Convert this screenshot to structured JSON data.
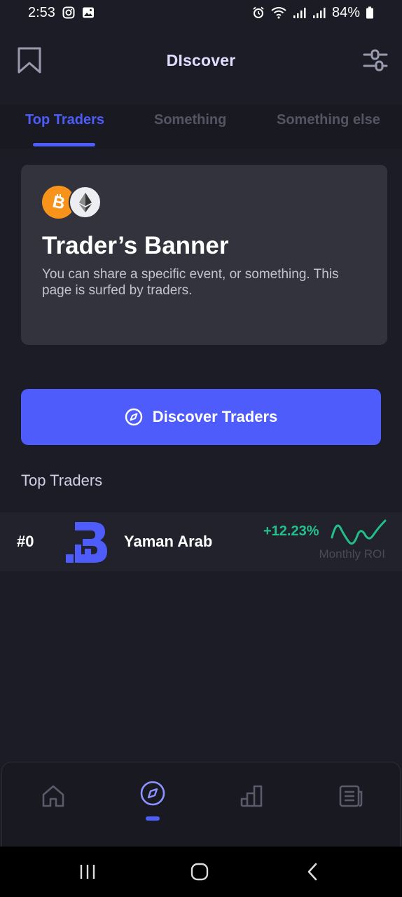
{
  "status_bar": {
    "time": "2:53",
    "battery": "84%"
  },
  "header": {
    "title": "DIscover"
  },
  "tabs": [
    {
      "label": "Top Traders",
      "active": true
    },
    {
      "label": "Something",
      "active": false
    },
    {
      "label": "Something else",
      "active": false
    }
  ],
  "banner": {
    "title": "Trader’s Banner",
    "text": "You can share a specific event, or something. This page is surfed by traders.",
    "coins": [
      "bitcoin-icon",
      "ethereum-icon"
    ]
  },
  "discover_button": {
    "label": "Discover Traders",
    "icon": "compass-icon"
  },
  "section": {
    "title": "Top Traders"
  },
  "traders": [
    {
      "rank": "#0",
      "name": "Yaman Arab",
      "roi": "+12.23%",
      "roi_label": "Monthly ROI"
    }
  ],
  "bottom_nav": {
    "items": [
      "home-icon",
      "compass-icon",
      "bar-chart-icon",
      "news-icon"
    ],
    "active_index": 1
  },
  "colors": {
    "background": "#1c1c27",
    "accent": "#4e5cfb",
    "positive": "#22c08a",
    "card": "#33333d"
  }
}
